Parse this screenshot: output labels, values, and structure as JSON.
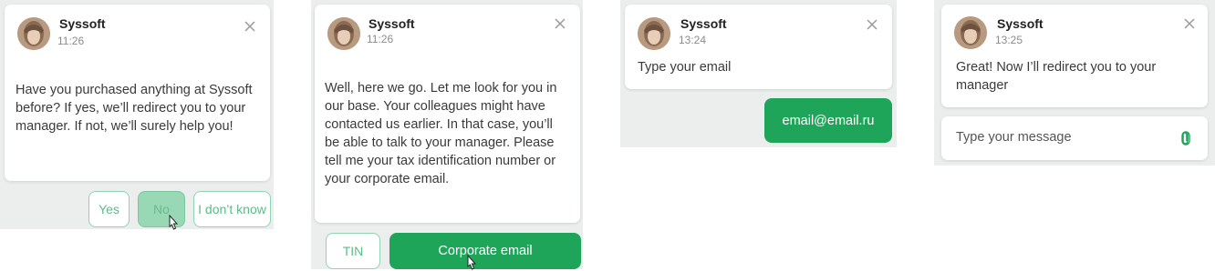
{
  "panel1": {
    "name": "Syssoft",
    "time": "11:26",
    "message": "Have you purchased anything at Syssoft before? If yes, we’ll redirect you to your manager. If not, we’ll surely help you!",
    "buttons": [
      "Yes",
      "No",
      "I don’t know"
    ]
  },
  "panel2": {
    "name": "Syssoft",
    "time": "11:26",
    "message": "Well, here we go. Let me look for you in our base. Your colleagues might have contacted us earlier. In that case, you’ll be able to talk to your manager. Please tell me your tax identification number or your corporate email.",
    "buttons": [
      "TIN",
      "Corporate email"
    ]
  },
  "panel3": {
    "name": "Syssoft",
    "time": "13:24",
    "message": "Type your email",
    "user_reply": "email@email.ru"
  },
  "panel4": {
    "name": "Syssoft",
    "time": "13:25",
    "message": "Great! Now I’ll redirect you to your manager",
    "input_placeholder": "Type your message"
  },
  "colors": {
    "accent": "#1fa55a",
    "outline": "#8fd3b0",
    "panel_bg": "#eceded"
  },
  "icons": [
    "avatar",
    "close-icon",
    "cursor-icon",
    "attach-icon"
  ]
}
